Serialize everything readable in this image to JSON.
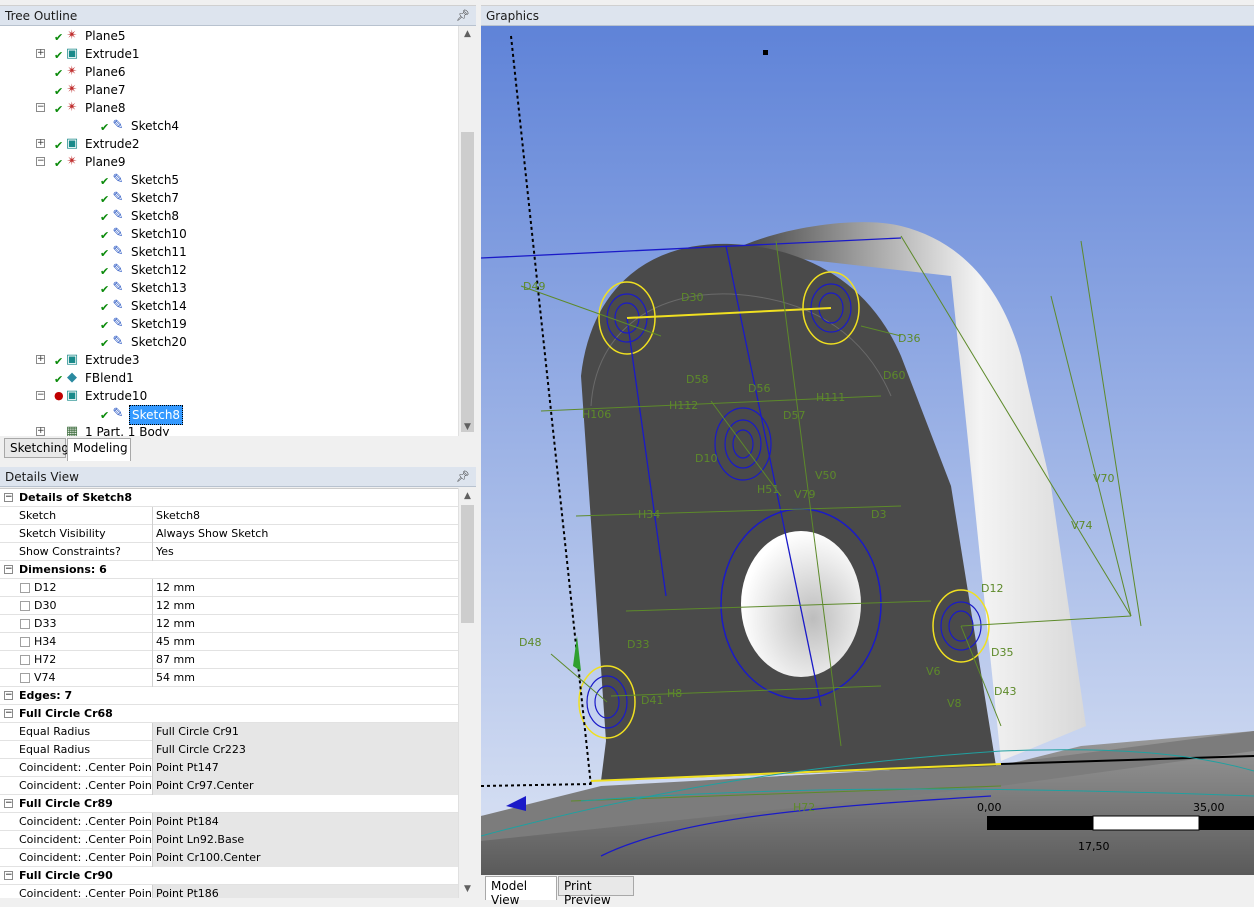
{
  "tree": {
    "title": "Tree Outline",
    "nodes": [
      {
        "label": "Plane5",
        "depth": 1,
        "icon": "plane-icon",
        "expander": "",
        "check": true
      },
      {
        "label": "Extrude1",
        "depth": 1,
        "icon": "extrude-icon",
        "expander": "+",
        "check": true
      },
      {
        "label": "Plane6",
        "depth": 1,
        "icon": "plane-icon",
        "expander": "",
        "check": true
      },
      {
        "label": "Plane7",
        "depth": 1,
        "icon": "plane-icon",
        "expander": "",
        "check": true
      },
      {
        "label": "Plane8",
        "depth": 1,
        "icon": "plane-icon",
        "expander": "-",
        "check": true
      },
      {
        "label": "Sketch4",
        "depth": 2,
        "icon": "sketch-icon",
        "expander": "",
        "check": true
      },
      {
        "label": "Extrude2",
        "depth": 1,
        "icon": "extrude-icon",
        "expander": "+",
        "check": true
      },
      {
        "label": "Plane9",
        "depth": 1,
        "icon": "plane-icon",
        "expander": "-",
        "check": true
      },
      {
        "label": "Sketch5",
        "depth": 2,
        "icon": "sketch-icon",
        "expander": "",
        "check": true
      },
      {
        "label": "Sketch7",
        "depth": 2,
        "icon": "sketch-icon",
        "expander": "",
        "check": true
      },
      {
        "label": "Sketch8",
        "depth": 2,
        "icon": "sketch-icon",
        "expander": "",
        "check": true
      },
      {
        "label": "Sketch10",
        "depth": 2,
        "icon": "sketch-icon",
        "expander": "",
        "check": true
      },
      {
        "label": "Sketch11",
        "depth": 2,
        "icon": "sketch-icon",
        "expander": "",
        "check": true
      },
      {
        "label": "Sketch12",
        "depth": 2,
        "icon": "sketch-icon",
        "expander": "",
        "check": true
      },
      {
        "label": "Sketch13",
        "depth": 2,
        "icon": "sketch-icon",
        "expander": "",
        "check": true
      },
      {
        "label": "Sketch14",
        "depth": 2,
        "icon": "sketch-icon",
        "expander": "",
        "check": true
      },
      {
        "label": "Sketch19",
        "depth": 2,
        "icon": "sketch-icon",
        "expander": "",
        "check": true
      },
      {
        "label": "Sketch20",
        "depth": 2,
        "icon": "sketch-icon",
        "expander": "",
        "check": true
      },
      {
        "label": "Extrude3",
        "depth": 1,
        "icon": "extrude-icon",
        "expander": "+",
        "check": true
      },
      {
        "label": "FBlend1",
        "depth": 1,
        "icon": "blend-icon",
        "expander": "",
        "check": true
      },
      {
        "label": "Extrude10",
        "depth": 1,
        "icon": "extrude-icon",
        "expander": "-",
        "check": false,
        "error": true
      },
      {
        "label": "Sketch8",
        "depth": 2,
        "icon": "sketch-icon",
        "expander": "",
        "check": true,
        "selected": true
      },
      {
        "label": "1 Part, 1 Body",
        "depth": 1,
        "icon": "part-icon",
        "expander": "+",
        "check": false
      }
    ],
    "tabs": [
      "Sketching",
      "Modeling"
    ],
    "active_tab": "Modeling"
  },
  "details": {
    "title": "Details View",
    "rows": [
      {
        "type": "group",
        "label": "Details of Sketch8"
      },
      {
        "type": "kv",
        "key": "Sketch",
        "value": "Sketch8"
      },
      {
        "type": "kv",
        "key": "Sketch Visibility",
        "value": "Always Show Sketch"
      },
      {
        "type": "kv",
        "key": "Show Constraints?",
        "value": "Yes"
      },
      {
        "type": "group",
        "label": "Dimensions: 6"
      },
      {
        "type": "dim",
        "key": "D12",
        "value": "12 mm"
      },
      {
        "type": "dim",
        "key": "D30",
        "value": "12 mm"
      },
      {
        "type": "dim",
        "key": "D33",
        "value": "12 mm"
      },
      {
        "type": "dim",
        "key": "H34",
        "value": "45 mm"
      },
      {
        "type": "dim",
        "key": "H72",
        "value": "87 mm"
      },
      {
        "type": "dim",
        "key": "V74",
        "value": "54 mm"
      },
      {
        "type": "group",
        "label": "Edges: 7"
      },
      {
        "type": "group",
        "label": "Full Circle Cr68"
      },
      {
        "type": "kv",
        "grey": true,
        "key": "Equal Radius",
        "value": "Full Circle Cr91"
      },
      {
        "type": "kv",
        "grey": true,
        "key": "Equal Radius",
        "value": "Full Circle Cr223"
      },
      {
        "type": "kv",
        "grey": true,
        "key": "Coincident: .Center Point",
        "value": "Point Pt147"
      },
      {
        "type": "kv",
        "grey": true,
        "key": "Coincident: .Center Point",
        "value": "Point Cr97.Center"
      },
      {
        "type": "group",
        "label": "Full Circle Cr89"
      },
      {
        "type": "kv",
        "grey": true,
        "key": "Coincident: .Center Point",
        "value": "Point Pt184"
      },
      {
        "type": "kv",
        "grey": true,
        "key": "Coincident: .Center Point",
        "value": "Point Ln92.Base"
      },
      {
        "type": "kv",
        "grey": true,
        "key": "Coincident: .Center Point",
        "value": "Point Cr100.Center"
      },
      {
        "type": "group",
        "label": "Full Circle Cr90"
      },
      {
        "type": "kv",
        "grey": true,
        "key": "Coincident: .Center Point",
        "value": "Point Pt186"
      }
    ]
  },
  "graphics": {
    "title": "Graphics",
    "dim_labels": [
      "D49",
      "D30",
      "D36",
      "D58",
      "D56",
      "D57",
      "H112",
      "H111",
      "H106",
      "D10",
      "H51",
      "V79",
      "V50",
      "H34",
      "D3",
      "V70",
      "V74",
      "D12",
      "D35",
      "D43",
      "D48",
      "D33",
      "D41",
      "H8",
      "V6",
      "V8",
      "H72",
      "D60"
    ],
    "scale": {
      "left": "0,00",
      "right": "35,00",
      "mid": "17,50"
    },
    "tabs": [
      "Model View",
      "Print Preview"
    ],
    "active_tab": "Model View",
    "colors": {
      "sketch": "#5d8a2a",
      "highlight": "#f0e020",
      "constraint": "#1a1ac8",
      "part": "#4a4a4a"
    }
  }
}
